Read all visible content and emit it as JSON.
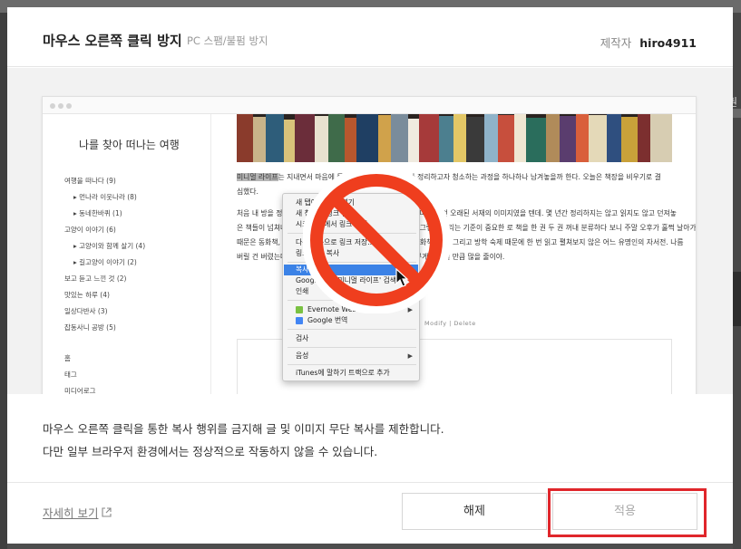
{
  "modal": {
    "title": "마우스 오른쪽 클릭 방지",
    "subtitle": "PC 스팸/불펌 방지",
    "author_label": "제작자",
    "author_name": "hiro4911",
    "description_line1": "마우스 오른쪽 클릭을 통한 복사 행위를 금지해 글 및 이미지 무단 복사를 제한합니다.",
    "description_line2": "다만 일부 브라우저 환경에서는 정상적으로 작동하지 않을 수 있습니다.",
    "more_link": "자세히 보기",
    "release_button": "해제",
    "apply_button": "적용",
    "highlight_color": "#e0262b"
  },
  "background": {
    "right_label": "권"
  },
  "preview": {
    "blog_title": "나를 찾아 떠나는 여행",
    "categories": [
      "여행을 떠나다 (9)",
      "먼나라 이웃나라 (8)",
      "동네한바퀴 (1)",
      "고양이 이야기 (6)",
      "고양이와 함께 살기 (4)",
      "길고양이 이야기 (2)",
      "보고 듣고 느낀 것 (2)",
      "맛있는 하루 (4)",
      "일상다반사 (3)",
      "잡동사니 공방 (5)"
    ],
    "nav": [
      "홈",
      "태그",
      "미디어로그"
    ],
    "post_line1_highlight": "미니멀 라이프",
    "post_line1_rest": "는 지내면서 마음에 들지 않는 것들을 하나하나 정리하고자 청소하는 과정을 하나하나 남겨놓을까 한다. 오늘은 책장을 비우기로 결",
    "post_line2": "심했다.",
    "post_line3": "처음 내 방을 정리하면서 가장 버리기 힘든 것이 책이었는데 아마도 그건 오래된 서재의 이미지였을 텐데. 몇 년간 정리하지는 않고 읽지도 않고 던져놓",
    "post_line4": "은 책들이 넘쳐나기 시작해서 정리하기로 마음먹었다. 모든 게 그렇듯 정리는 기준이 중요한 로 책을 한 권 두 권 꺼내 분류하다 보니 주말 오후가 훌쩍 날아가 버렸다.",
    "post_line5": "때문은 동화책, 전공서적, 학창 시절 참고서, 두꺼운 소설책, 만화책, 잡지 그리고 방학 숙제 때문에 한 번 읽고 펼쳐보지 않은 어느 유명인의 자서전. 나름",
    "post_line6": "버릴 건 버렸는데 아직 다 정리하지는 못했다. 그래도 책장의 무게를 느낄 만큼 많을 줄이야.",
    "modify_label": "Modify  |  Delete"
  },
  "context_menu": {
    "items": [
      "새 탭에서 링크 열기",
      "새 창에서 링크 열기",
      "시크릿 창에서 링크 열기",
      "다른 이름으로 링크 저장...",
      "링크 주소 복사",
      "복사",
      "Google에서 '미니멀 라이프' 검색",
      "인쇄",
      "Evernote Web Clipper",
      "Google 번역",
      "검사",
      "음성",
      "iTunes에 말하기 트랙으로 추가"
    ]
  }
}
